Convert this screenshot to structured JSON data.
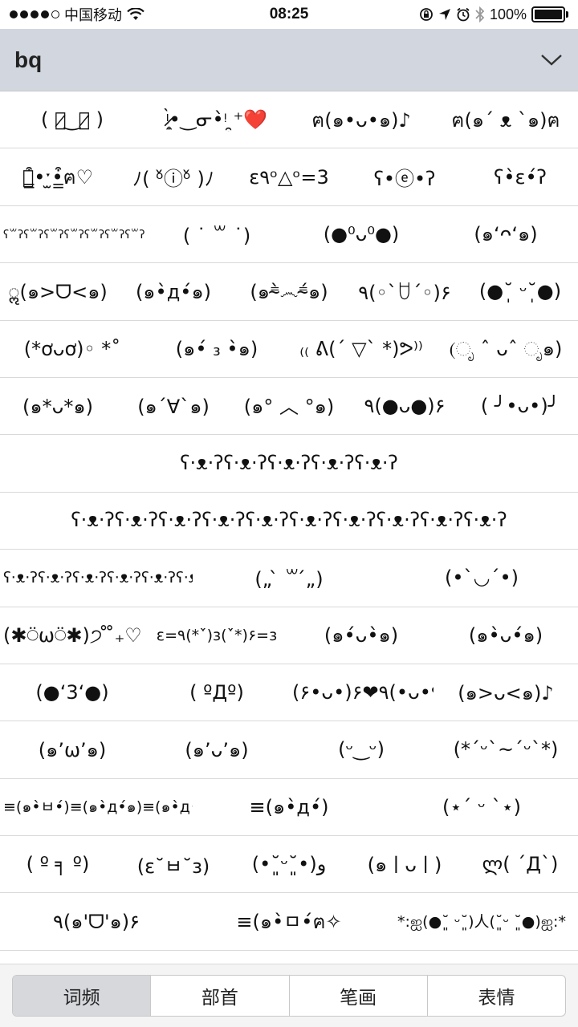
{
  "status_bar": {
    "carrier": "中国移动",
    "time": "08:25",
    "battery": "100%"
  },
  "header": {
    "title": "bq"
  },
  "emoticon_rows": [
    [
      "( ꈨ̷ ͜ ꈨ̷ )",
      "ᵎ̷̯͙̀•‿ᓂ•̀ᵎ ̯̩⁺❤️",
      "ฅ(๑•ᴗ•๑)♪",
      "ฅ(๑ˊ ᴥ ˋ๑)ฅ"
    ],
    [
      "ฅ̳͒•ˑ̫•̳͒ฅ♡",
      "ﾉ( ᵒ̌ⓘᵒ̌ )ﾉ",
      "ε٩ᵒ△ᵒ=3",
      "ʕ•ⓔ•ʔ",
      "ʕ•̀ε•́ʔ"
    ],
    [
      "ʕ꒳ʔʕ꒳ʔʕ꒳ʔʕ꒳ʔʕ꒳ʔʕ꒳ʔʕ꒳ʔ",
      "( ˙ ꒳ ˙)",
      "(●⁰ᴗ⁰●)",
      "(๑‘ᴖ‘๑)"
    ],
    [
      "ॢ(๑>ᗜ<๑)",
      "(๑•̀д•́๑)",
      "(๑⁼̴̀෴⁼̴́๑)",
      "٩(◦`ꇴ´◦)۶",
      "(●˘̩̩̩̩͈ ᵕ˘̩̩̩̩͈●)"
    ],
    [
      "(*ơᴗơ)◦ *˚",
      "(๑•́ ₃ •̀๑)",
      "₍₍ ᕕ(´ ▽` *)ᕗ⁾⁾",
      "(ೃ ˆ ᴗˆ ೃ๑)"
    ],
    [
      "(๑*ᴗ*๑)",
      "(๑´∀`๑)",
      "(๑° ︿ °๑)",
      "٩(●ᴗ●)۶",
      "( ╯•ᴗ•)╯"
    ],
    [
      "ʕ·ᴥ·ʔʕ·ᴥ·ʔʕ·ᴥ·ʔʕ·ᴥ·ʔʕ·ᴥ·ʔ"
    ],
    [
      "ʕ·ᴥ·ʔʕ·ᴥ·ʔʕ·ᴥ·ʔʕ·ᴥ·ʔʕ·ᴥ·ʔʕ·ᴥ·ʔʕ·ᴥ·ʔʕ·ᴥ·ʔʕ·ᴥ·ʔʕ·ᴥ·ʔ"
    ],
    [
      "ʕ·ᴥ·ʔʕ·ᴥ·ʔʕ·ᴥ·ʔʕ·ᴥ·ʔʕ·ᴥ·ʔʕ·ᴥ·ʔ",
      "(„ ̀ ꒳ ́„)",
      "(•`◡´•)"
    ],
    [
      "(✱⍥ω⍥✱)੭ ̊ ̊₊♡",
      "ε=٩(*´̀)з(´̀*)۶=з",
      "(๑•́ᴗ•̀๑)",
      "(๑•̀ᴗ•́๑)"
    ],
    [
      "(●‘3‘●)",
      "( ºДº)",
      "(۶•ᴗ•)۶❤٩(•ᴗ•٩)",
      "(๑>ᴗ<๑)♪"
    ],
    [
      "(๑’ω’๑)",
      "(๑’ᴗ’๑)",
      "(ᵕ‿ᵕ)",
      "(*ˊᵕˋ~ˊᵕˋ*)"
    ],
    [
      "≡(๑•̀ㅂ•́)≡(๑•̀д•́๑)≡(๑•̀д•́",
      "≡(๑•̀д•́)",
      "(⋆ˊ ᵕ ˋ⋆)"
    ],
    [
      "( º ╕ º)",
      "(ε˘ㅂ˘з)",
      "(•˘͈ᵕ˘͈•)و",
      "(๑ㅣᴗㅣ)",
      "ლ( ´Д`)"
    ],
    [
      "٩(๑'ᗜ'๑)۶",
      "≡(๑•̀ㅁ•́ฅ✧",
      "*:ஐ(●˘͈ ᵕ˘͈)人(˘͈ᵕ ˘͈●)ஐ:*"
    ]
  ],
  "tabs": [
    {
      "label": "词频",
      "active": true
    },
    {
      "label": "部首",
      "active": false
    },
    {
      "label": "笔画",
      "active": false
    },
    {
      "label": "表情",
      "active": false
    }
  ]
}
